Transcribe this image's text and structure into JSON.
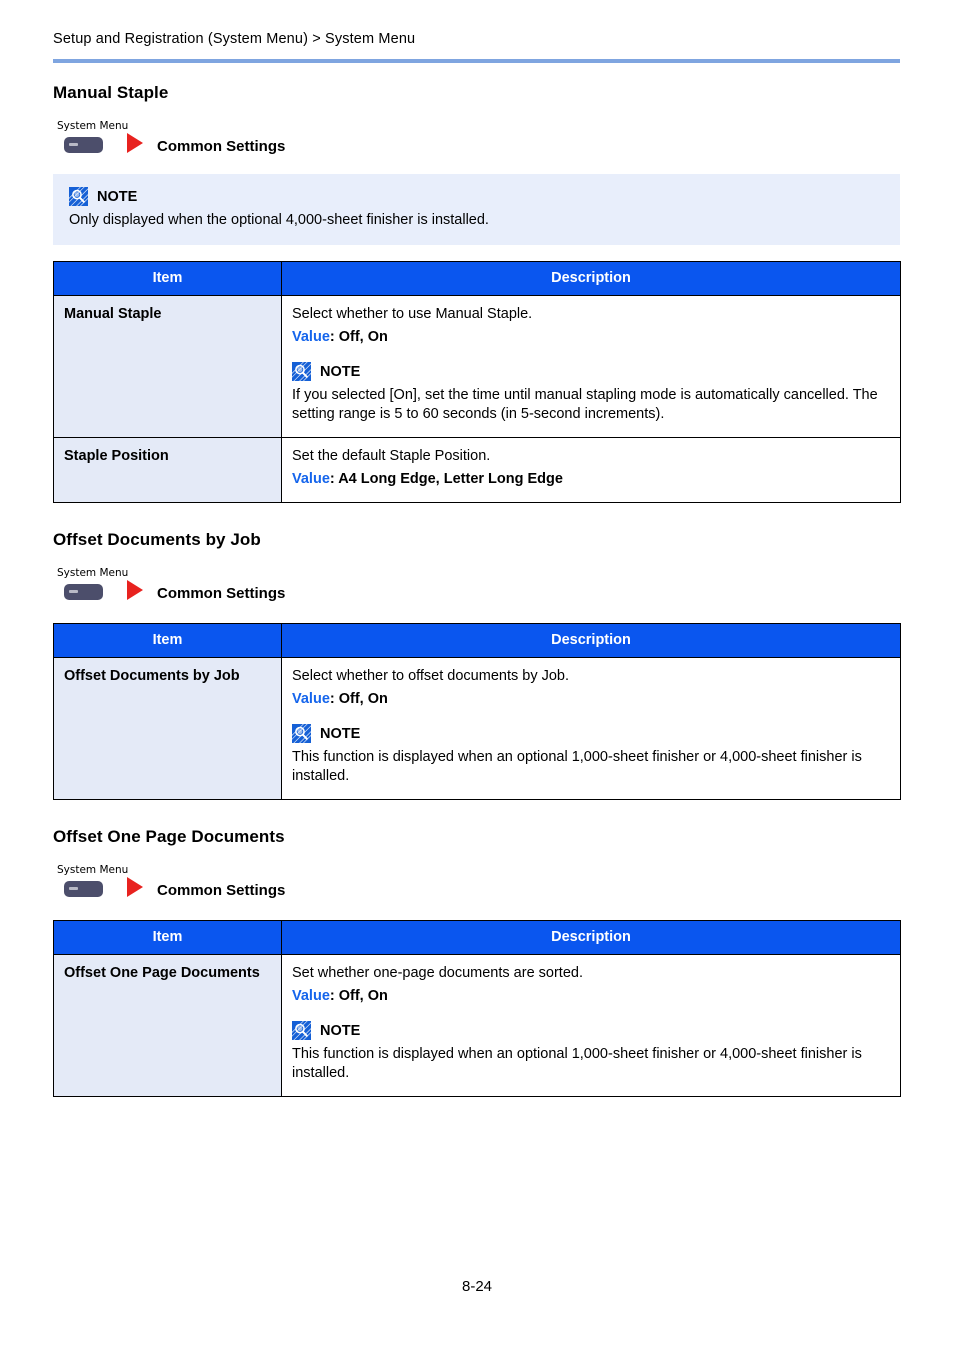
{
  "page": {
    "running_header": "Setup and Registration (System Menu) > System Menu",
    "folio": "8-24",
    "rule_color": "#7fa5e0"
  },
  "icons": {
    "note": "note-magnifier-icon",
    "system_menu_key": "system-menu-key-icon",
    "arrow": "right-arrow-icon"
  },
  "colors": {
    "table_header_bg": "#0a56ef",
    "item_cell_bg": "#e4eaf7",
    "note_box_bg": "#e8eefb",
    "value_label": "#1565ec",
    "arrow_red": "#e8221f",
    "key_body": "#4c4e6b"
  },
  "table_headers": {
    "item": "Item",
    "description": "Description"
  },
  "labels": {
    "note": "NOTE",
    "value_key": "Value",
    "system_menu": "System Menu"
  },
  "sections": [
    {
      "title": "Manual Staple",
      "nav": {
        "key_label": "System Menu",
        "target": "Common Settings"
      },
      "note": {
        "label": "NOTE",
        "text": "Only displayed when the optional 4,000-sheet finisher is installed."
      },
      "rows": [
        {
          "item": "Manual Staple",
          "desc": "Select whether to use Manual Staple.",
          "value_key": "Value",
          "value_text": ": Off, On",
          "note": {
            "label": "NOTE",
            "text": "If you selected [On], set the time until manual stapling mode is automatically cancelled. The setting range is 5 to 60 seconds (in 5-second increments)."
          }
        },
        {
          "item": "Staple Position",
          "desc": "Set the default Staple Position.",
          "value_key": "Value",
          "value_text": ": A4 Long Edge, Letter Long Edge"
        }
      ]
    },
    {
      "title": "Offset Documents by Job",
      "nav": {
        "key_label": "System Menu",
        "target": "Common Settings"
      },
      "rows": [
        {
          "item": "Offset Documents by Job",
          "desc": "Select whether to offset documents by Job.",
          "value_key": "Value",
          "value_text": ": Off, On",
          "note": {
            "label": "NOTE",
            "text": "This function is displayed when an optional 1,000-sheet finisher or 4,000-sheet finisher is installed."
          }
        }
      ]
    },
    {
      "title": "Offset One Page Documents",
      "nav": {
        "key_label": "System Menu",
        "target": "Common Settings"
      },
      "rows": [
        {
          "item": "Offset One Page Documents",
          "desc": "Set whether one-page documents are sorted.",
          "value_key": "Value",
          "value_text": ": Off, On",
          "note": {
            "label": "NOTE",
            "text": "This function is displayed when an optional 1,000-sheet finisher or 4,000-sheet finisher is installed."
          }
        }
      ]
    }
  ]
}
